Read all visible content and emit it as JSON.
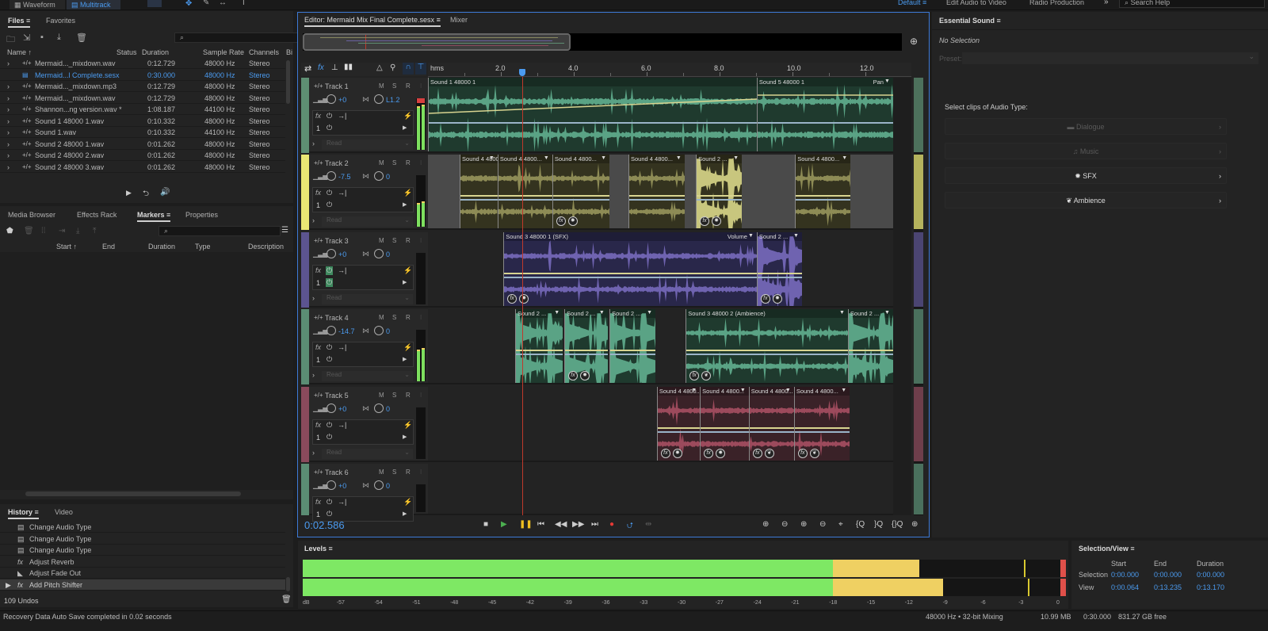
{
  "topbar": {
    "modes": [
      "Waveform",
      "Multitrack"
    ],
    "active_mode": "Multitrack",
    "workspaces": [
      "Default",
      "Edit Audio to Video",
      "Radio Production"
    ],
    "overflow": "»",
    "search_placeholder": "Search Help"
  },
  "files_panel": {
    "tabs": [
      "Files",
      "Favorites"
    ],
    "columns": [
      "Name ↑",
      "Status",
      "Duration",
      "Sample Rate",
      "Channels",
      "Bi"
    ],
    "rows": [
      {
        "name": "Mermaid..._mixdown.wav",
        "duration": "0:12.729",
        "rate": "48000 Hz",
        "channels": "Stereo",
        "type": "wav"
      },
      {
        "name": "Mermaid...l Complete.sesx",
        "duration": "0:30.000",
        "rate": "48000 Hz",
        "channels": "Stereo",
        "type": "session",
        "active": true
      },
      {
        "name": "Mermaid..._mixdown.mp3",
        "duration": "0:12.729",
        "rate": "48000 Hz",
        "channels": "Stereo",
        "type": "wav"
      },
      {
        "name": "Mermaid..._mixdown.wav",
        "duration": "0:12.729",
        "rate": "48000 Hz",
        "channels": "Stereo",
        "type": "wav"
      },
      {
        "name": "Shannon...ng version.wav *",
        "duration": "1:08.187",
        "rate": "44100 Hz",
        "channels": "Stereo",
        "type": "wav"
      },
      {
        "name": "Sound 1 48000 1.wav",
        "duration": "0:10.332",
        "rate": "48000 Hz",
        "channels": "Stereo",
        "type": "wav"
      },
      {
        "name": "Sound 1.wav",
        "duration": "0:10.332",
        "rate": "44100 Hz",
        "channels": "Stereo",
        "type": "wav"
      },
      {
        "name": "Sound 2 48000 1.wav",
        "duration": "0:01.262",
        "rate": "48000 Hz",
        "channels": "Stereo",
        "type": "wav"
      },
      {
        "name": "Sound 2 48000 2.wav",
        "duration": "0:01.262",
        "rate": "48000 Hz",
        "channels": "Stereo",
        "type": "wav"
      },
      {
        "name": "Sound 2 48000 3.wav",
        "duration": "0:01.262",
        "rate": "48000 Hz",
        "channels": "Stereo",
        "type": "wav"
      }
    ]
  },
  "markers_panel": {
    "tabs": [
      "Media Browser",
      "Effects Rack",
      "Markers",
      "Properties"
    ],
    "active_tab": "Markers",
    "columns": [
      "Start ↑",
      "End",
      "Duration",
      "Type",
      "Description"
    ]
  },
  "history_panel": {
    "tabs": [
      "History",
      "Video"
    ],
    "items": [
      {
        "label": "Change Audio Type",
        "icon": "list"
      },
      {
        "label": "Change Audio Type",
        "icon": "list"
      },
      {
        "label": "Change Audio Type",
        "icon": "list"
      },
      {
        "label": "Adjust Reverb",
        "icon": "fx"
      },
      {
        "label": "Adjust Fade Out",
        "icon": "fade"
      },
      {
        "label": "Add Pitch Shifter",
        "icon": "fx",
        "current": true
      }
    ],
    "undos": "109 Undos"
  },
  "editor": {
    "tabs": [
      "Editor: Mermaid Mix Final Complete.sesx",
      "Mixer"
    ],
    "ruler_unit": "hms",
    "ruler_ticks": [
      "2.0",
      "4.0",
      "6.0",
      "8.0",
      "10.0",
      "12.0"
    ],
    "playhead_seconds": 2.586,
    "current_time": "0:02.586",
    "tracks": [
      {
        "name": "Track 1",
        "volume": "+0",
        "pan": "L1.2",
        "read": "Read",
        "color": "#5e8f73",
        "clips": [
          {
            "label": "Sound 1 48000 1",
            "start": 0,
            "end": 9.02,
            "extra": "",
            "badges": []
          },
          {
            "label": "Sound 5 48000 1",
            "start": 9.02,
            "end": 12.76,
            "extra": "Pan",
            "badges": []
          }
        ]
      },
      {
        "name": "Track 2",
        "volume": "-7.5",
        "pan": "0",
        "read": "Read",
        "color": "#e9e774",
        "clips": [
          {
            "label": "Sound 4 4800...",
            "start": 0.87,
            "end": 1.91,
            "badges": []
          },
          {
            "label": "Sound 4 4800...",
            "start": 1.91,
            "end": 3.41,
            "badges": []
          },
          {
            "label": "Sound 4 4800...",
            "start": 3.41,
            "end": 4.98,
            "badges": [
              "fx",
              "sfx"
            ]
          },
          {
            "label": "Sound 4 4800...",
            "start": 5.5,
            "end": 7.04,
            "badges": []
          },
          {
            "label": "Sound 2 ...",
            "start": 7.35,
            "end": 8.61,
            "badges": [
              "fx",
              "sfx"
            ],
            "loud": true
          },
          {
            "label": "Sound 4 4800...",
            "start": 10.07,
            "end": 11.59,
            "badges": []
          }
        ]
      },
      {
        "name": "Track 3",
        "volume": "+0",
        "pan": "0",
        "read": "Read",
        "color": "#5c5490",
        "clips": [
          {
            "label": "Sound 3 48000 1 (SFX)",
            "start": 2.07,
            "end": 9.02,
            "extra": "Volume",
            "badges": [
              "fx",
              "sfx"
            ]
          },
          {
            "label": "Sound 2 ...",
            "start": 9.02,
            "end": 10.26,
            "badges": [
              "fx",
              "sfx"
            ],
            "loud": true
          }
        ]
      },
      {
        "name": "Track 4",
        "volume": "-14.7",
        "pan": "0",
        "read": "Read",
        "color": "#5b8d74",
        "clips": [
          {
            "label": "Sound 2 ...",
            "start": 2.39,
            "end": 3.7,
            "badges": [],
            "loud": true
          },
          {
            "label": "Sound 2 ...",
            "start": 3.74,
            "end": 4.93,
            "badges": [
              "fx",
              "sfx"
            ],
            "loud": true
          },
          {
            "label": "Sound 2 ...",
            "start": 4.98,
            "end": 6.24,
            "badges": [],
            "loud": true
          },
          {
            "label": "Sound 3 48000 2 (Ambience)",
            "start": 7.07,
            "end": 11.52,
            "badges": [
              "fx",
              "amb"
            ]
          },
          {
            "label": "Sound 2 ...",
            "start": 11.52,
            "end": 12.76,
            "badges": [],
            "loud": true
          }
        ]
      },
      {
        "name": "Track 5",
        "volume": "+0",
        "pan": "0",
        "read": "Read",
        "color": "#8a4a5c",
        "clips": [
          {
            "label": "Sound 4 4800...",
            "start": 6.28,
            "end": 7.46,
            "badges": [
              "fx",
              "sfx"
            ]
          },
          {
            "label": "Sound 4 4800...",
            "start": 7.46,
            "end": 8.8,
            "badges": [
              "fx",
              "sfx"
            ]
          },
          {
            "label": "Sound 4 4800...",
            "start": 8.8,
            "end": 10.04,
            "badges": [
              "fx",
              "amb"
            ]
          },
          {
            "label": "Sound 4 4800...",
            "start": 10.04,
            "end": 11.57,
            "badges": [
              "fx",
              "amb"
            ]
          }
        ]
      },
      {
        "name": "Track 6",
        "volume": "+0",
        "pan": "0",
        "read": "Read",
        "color": "#5b8d74",
        "clips": []
      }
    ],
    "track_buttons": [
      "M",
      "S",
      "R"
    ],
    "insert_slot": "1"
  },
  "essential_sound": {
    "title": "Essential Sound",
    "selection": "No Selection",
    "preset_label": "Preset:",
    "prompt": "Select clips of Audio Type:",
    "types": [
      {
        "label": "Dialogue",
        "enabled": false
      },
      {
        "label": "Music",
        "enabled": false
      },
      {
        "label": "SFX",
        "enabled": true
      },
      {
        "label": "Ambience",
        "enabled": true
      }
    ]
  },
  "levels": {
    "title": "Levels",
    "scale": [
      "dB",
      "-57",
      "-54",
      "-51",
      "-48",
      "-45",
      "-42",
      "-39",
      "-36",
      "-33",
      "-30",
      "-27",
      "-24",
      "-21",
      "-18",
      "-15",
      "-12",
      "-9",
      "-6",
      "-3",
      "0"
    ],
    "left_db": -11.2,
    "right_db": -9.3,
    "left_peak_db": -2.9,
    "right_peak_db": -2.6
  },
  "selection_view": {
    "title": "Selection/View",
    "columns": [
      "Start",
      "End",
      "Duration"
    ],
    "rows": [
      {
        "label": "Selection",
        "start": "0:00.000",
        "end": "0:00.000",
        "duration": "0:00.000"
      },
      {
        "label": "View",
        "start": "0:00.064",
        "end": "0:13.235",
        "duration": "0:13.170"
      }
    ]
  },
  "status_bar": {
    "message": "Recovery Data Auto Save completed in 0.02 seconds",
    "format": "48000 Hz • 32-bit Mixing",
    "size": "10.99 MB",
    "duration": "0:30.000",
    "free": "831.27 GB free"
  }
}
